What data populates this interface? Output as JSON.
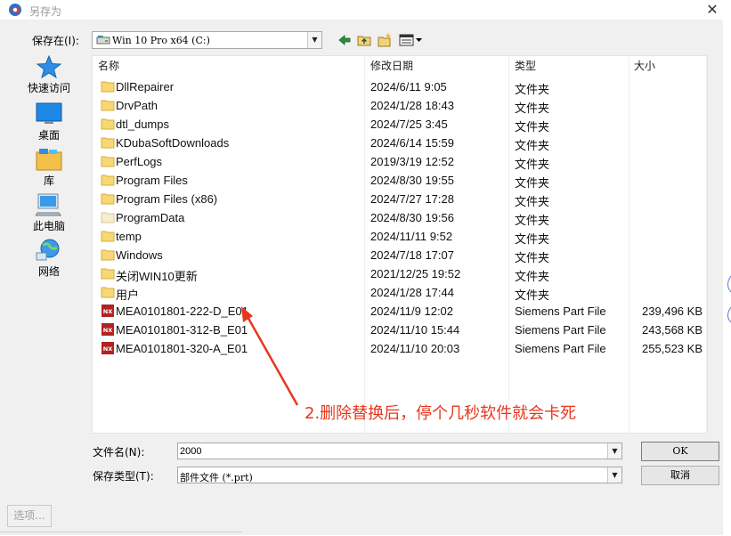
{
  "window": {
    "title": "另存为",
    "close_glyph": "✕"
  },
  "location": {
    "label": "保存在(I):",
    "value": "Win 10 Pro x64 (C:)",
    "icon": "drive-icon"
  },
  "toolbar": {
    "back": "back-icon",
    "up": "up-folder-icon",
    "new_folder": "new-folder-icon",
    "view": "view-menu-icon"
  },
  "places": [
    {
      "label": "快速访问",
      "icon": "star-icon"
    },
    {
      "label": "桌面",
      "icon": "desktop-icon"
    },
    {
      "label": "库",
      "icon": "library-icon"
    },
    {
      "label": "此电脑",
      "icon": "computer-icon"
    },
    {
      "label": "网络",
      "icon": "network-icon"
    }
  ],
  "columns": {
    "name": "名称",
    "date": "修改日期",
    "type": "类型",
    "size": "大小"
  },
  "files": [
    {
      "name": "DllRepairer",
      "date": "2024/6/11 9:05",
      "type": "文件夹",
      "size": "",
      "kind": "folder"
    },
    {
      "name": "DrvPath",
      "date": "2024/1/28 18:43",
      "type": "文件夹",
      "size": "",
      "kind": "folder"
    },
    {
      "name": "dtl_dumps",
      "date": "2024/7/25 3:45",
      "type": "文件夹",
      "size": "",
      "kind": "folder"
    },
    {
      "name": "KDubaSoftDownloads",
      "date": "2024/6/14 15:59",
      "type": "文件夹",
      "size": "",
      "kind": "folder"
    },
    {
      "name": "PerfLogs",
      "date": "2019/3/19 12:52",
      "type": "文件夹",
      "size": "",
      "kind": "folder"
    },
    {
      "name": "Program Files",
      "date": "2024/8/30 19:55",
      "type": "文件夹",
      "size": "",
      "kind": "folder"
    },
    {
      "name": "Program Files (x86)",
      "date": "2024/7/27 17:28",
      "type": "文件夹",
      "size": "",
      "kind": "folder"
    },
    {
      "name": "ProgramData",
      "date": "2024/8/30 19:56",
      "type": "文件夹",
      "size": "",
      "kind": "folder-hidden"
    },
    {
      "name": "temp",
      "date": "2024/11/11 9:52",
      "type": "文件夹",
      "size": "",
      "kind": "folder"
    },
    {
      "name": "Windows",
      "date": "2024/7/18 17:07",
      "type": "文件夹",
      "size": "",
      "kind": "folder"
    },
    {
      "name": "关闭WIN10更新",
      "date": "2021/12/25 19:52",
      "type": "文件夹",
      "size": "",
      "kind": "folder"
    },
    {
      "name": "用户",
      "date": "2024/1/28 17:44",
      "type": "文件夹",
      "size": "",
      "kind": "folder"
    },
    {
      "name": "MEA0101801-222-D_E01",
      "date": "2024/11/9 12:02",
      "type": "Siemens Part File",
      "size": "239,496 KB",
      "kind": "nx"
    },
    {
      "name": "MEA0101801-312-B_E01",
      "date": "2024/11/10 15:44",
      "type": "Siemens Part File",
      "size": "243,568 KB",
      "kind": "nx"
    },
    {
      "name": "MEA0101801-320-A_E01",
      "date": "2024/11/10 20:03",
      "type": "Siemens Part File",
      "size": "255,523 KB",
      "kind": "nx"
    }
  ],
  "annotation": {
    "text": "2.删除替换后，停个几秒软件就会卡死",
    "color": "#e8361e"
  },
  "filename": {
    "label": "文件名(N):",
    "value": "2000"
  },
  "filetype": {
    "label": "保存类型(T):",
    "value": "部件文件 (*.prt)"
  },
  "buttons": {
    "ok": "OK",
    "cancel": "取消",
    "options": "选项..."
  },
  "nx_badge": "NX"
}
